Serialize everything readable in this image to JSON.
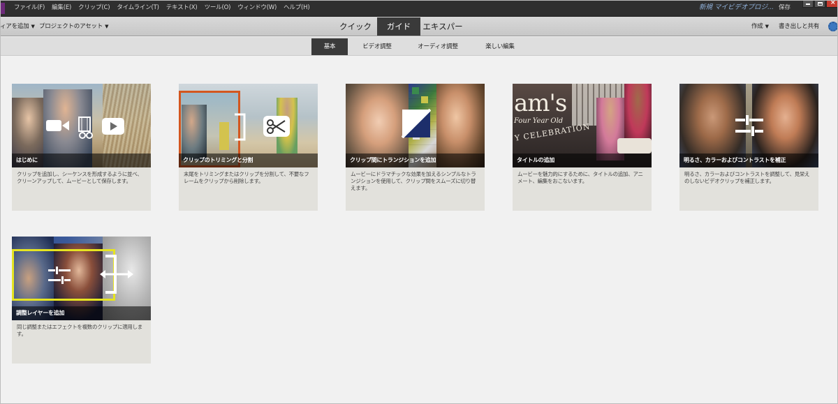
{
  "menubar": {
    "items": [
      "ファイル(F)",
      "編集(E)",
      "クリップ(C)",
      "タイムライン(T)",
      "テキスト(X)",
      "ツール(O)",
      "ウィンドウ(W)",
      "ヘルプ(H)"
    ],
    "project_name": "新規 マイビデオプロジ...",
    "save_label": "保存"
  },
  "toolbar": {
    "add_media": "ィアを追加",
    "project_assets": "プロジェクトのアセット",
    "modes": [
      "クイック",
      "ガイド",
      "エキスパート"
    ],
    "active_mode": "ガイド",
    "create": "作成",
    "write_share": "書き出しと共有"
  },
  "subtabs": {
    "items": [
      "基本",
      "ビデオ調整",
      "オーディオ調整",
      "楽しい編集"
    ],
    "active": "基本"
  },
  "cards": [
    {
      "title": "はじめに",
      "desc": "クリップを追加し、シーケンスを形成するように並べ、クリーンアップして、ムービーとして保存します。"
    },
    {
      "title": "クリップのトリミングと分割",
      "desc": "末尾をトリミングまたはクリップを分割して、不要なフレームをクリップから削除します。"
    },
    {
      "title": "クリップ間にトランジションを追加",
      "desc": "ムービーにドラマチックな効果を加えるシンプルなトランジションを使用して、クリップ間をスムーズに切り替えます。"
    },
    {
      "title": "タイトルの追加",
      "desc": "ムービーを魅力的にするために、タイトルの追加、アニメート、編集をおこないます。",
      "image_text": [
        "am's",
        "Four Year Old",
        "Y CELEBRATION"
      ]
    },
    {
      "title": "明るさ、カラーおよびコントラストを補正",
      "desc": "明るさ、カラーおよびコントラストを調整して、見栄えのしないビデオクリップを補正します。"
    },
    {
      "title": "調整レイヤーを追加",
      "desc": "同じ調整またはエフェクトを複数のクリップに適用します。"
    }
  ],
  "colors": {
    "menubar_bg": "#2f2f2f",
    "toolbar_bg": "#d0d0d0",
    "active_tab_bg": "#3a3a3a",
    "card_bg": "#e2e1dc",
    "project_name": "#8fb0d9"
  }
}
